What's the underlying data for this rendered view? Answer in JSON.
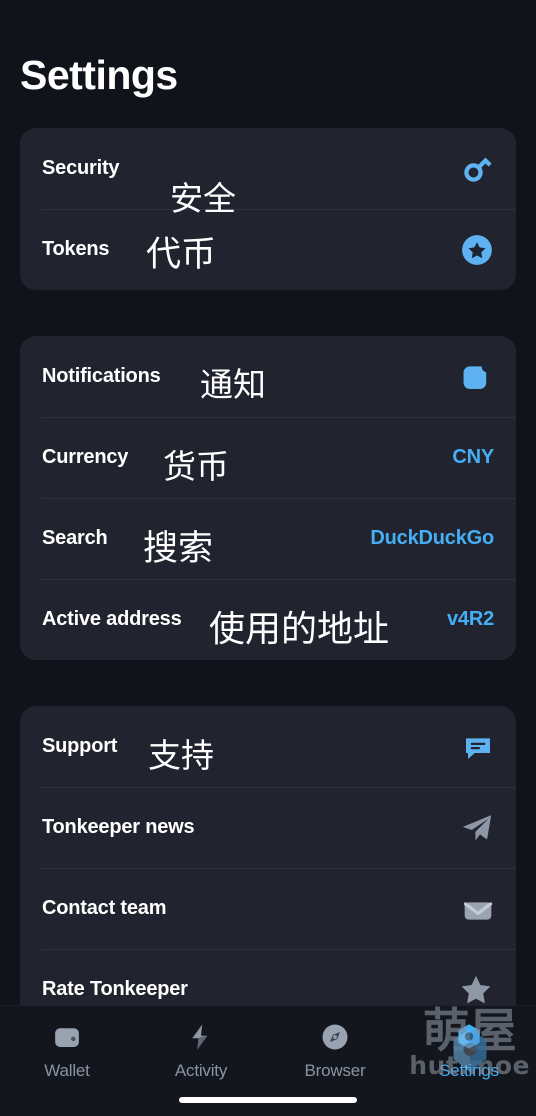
{
  "header": {
    "title": "Settings"
  },
  "colors": {
    "background": "#10131a",
    "card": "#21242e",
    "accent": "#45aef5",
    "text": "#ffffff",
    "muted": "#8994a3",
    "divider": "#2c3040"
  },
  "cards": [
    {
      "rows": [
        {
          "label": "Security",
          "cn": "安全",
          "icon": "key-icon",
          "value": ""
        },
        {
          "label": "Tokens",
          "cn": "代币",
          "icon": "star-badge-icon",
          "value": ""
        }
      ]
    },
    {
      "rows": [
        {
          "label": "Notifications",
          "cn": "通知",
          "icon": "notification-square-icon",
          "value": ""
        },
        {
          "label": "Currency",
          "cn": "货币",
          "icon": "",
          "value": "CNY"
        },
        {
          "label": "Search",
          "cn": "搜索",
          "icon": "",
          "value": "DuckDuckGo"
        },
        {
          "label": "Active address",
          "cn": "使用的地址",
          "icon": "",
          "value": "v4R2"
        }
      ]
    },
    {
      "rows": [
        {
          "label": "Support",
          "cn": "支持",
          "icon": "chat-bubble-icon",
          "value": ""
        },
        {
          "label": "Tonkeeper news",
          "cn": "",
          "icon": "telegram-icon",
          "value": ""
        },
        {
          "label": "Contact team",
          "cn": "",
          "icon": "envelope-icon",
          "value": ""
        },
        {
          "label": "Rate Tonkeeper",
          "cn": "",
          "icon": "star-icon",
          "value": ""
        }
      ]
    }
  ],
  "tabbar": {
    "tabs": [
      {
        "label": "Wallet",
        "icon": "wallet-icon",
        "active": false
      },
      {
        "label": "Activity",
        "icon": "lightning-icon",
        "active": false
      },
      {
        "label": "Browser",
        "icon": "compass-icon",
        "active": false
      },
      {
        "label": "Settings",
        "icon": "gear-icon",
        "active": true
      }
    ]
  },
  "watermark": {
    "cjk": "萌屋",
    "latin": "hut.moe"
  }
}
